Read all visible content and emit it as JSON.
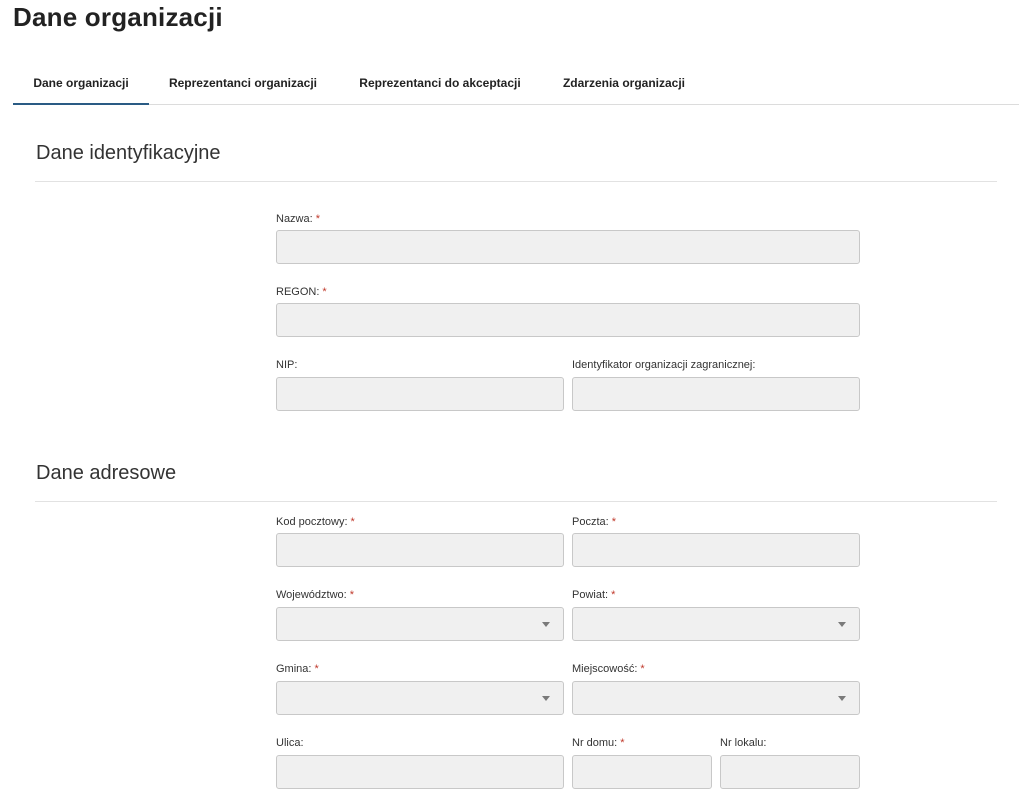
{
  "page": {
    "title": "Dane organizacji"
  },
  "tabs": [
    {
      "label": "Dane organizacji",
      "active": true
    },
    {
      "label": "Reprezentanci organizacji",
      "active": false
    },
    {
      "label": "Reprezentanci do akceptacji",
      "active": false
    },
    {
      "label": "Zdarzenia organizacji",
      "active": false
    }
  ],
  "sections": {
    "identification": {
      "title": "Dane identyfikacyjne",
      "fields": {
        "nazwa": {
          "label": "Nazwa:",
          "required": "*",
          "value": ""
        },
        "regon": {
          "label": "REGON:",
          "required": "*",
          "value": ""
        },
        "nip": {
          "label": "NIP:",
          "value": ""
        },
        "foreign_id": {
          "label": "Identyfikator organizacji zagranicznej:",
          "value": ""
        }
      }
    },
    "address": {
      "title": "Dane adresowe",
      "fields": {
        "kod_pocztowy": {
          "label": "Kod pocztowy:",
          "required": "*",
          "value": ""
        },
        "poczta": {
          "label": "Poczta:",
          "required": "*",
          "value": ""
        },
        "wojewodztwo": {
          "label": "Województwo:",
          "required": "*",
          "value": ""
        },
        "powiat": {
          "label": "Powiat:",
          "required": "*",
          "value": ""
        },
        "gmina": {
          "label": "Gmina:",
          "required": "*",
          "value": ""
        },
        "miejscowosc": {
          "label": "Miejscowość:",
          "required": "*",
          "value": ""
        },
        "ulica": {
          "label": "Ulica:",
          "value": ""
        },
        "nr_domu": {
          "label": "Nr domu:",
          "required": "*",
          "value": ""
        },
        "nr_lokalu": {
          "label": "Nr lokalu:",
          "value": ""
        }
      }
    }
  },
  "icons": {
    "dropdown": "chevron-down-icon"
  },
  "colors": {
    "text": "#222222",
    "required": "#c0392b",
    "active_tab_underline": "#2a5b84",
    "input_bg": "#f0f0f0",
    "input_border": "#c8c8c8",
    "rule": "#e2e2e2"
  }
}
